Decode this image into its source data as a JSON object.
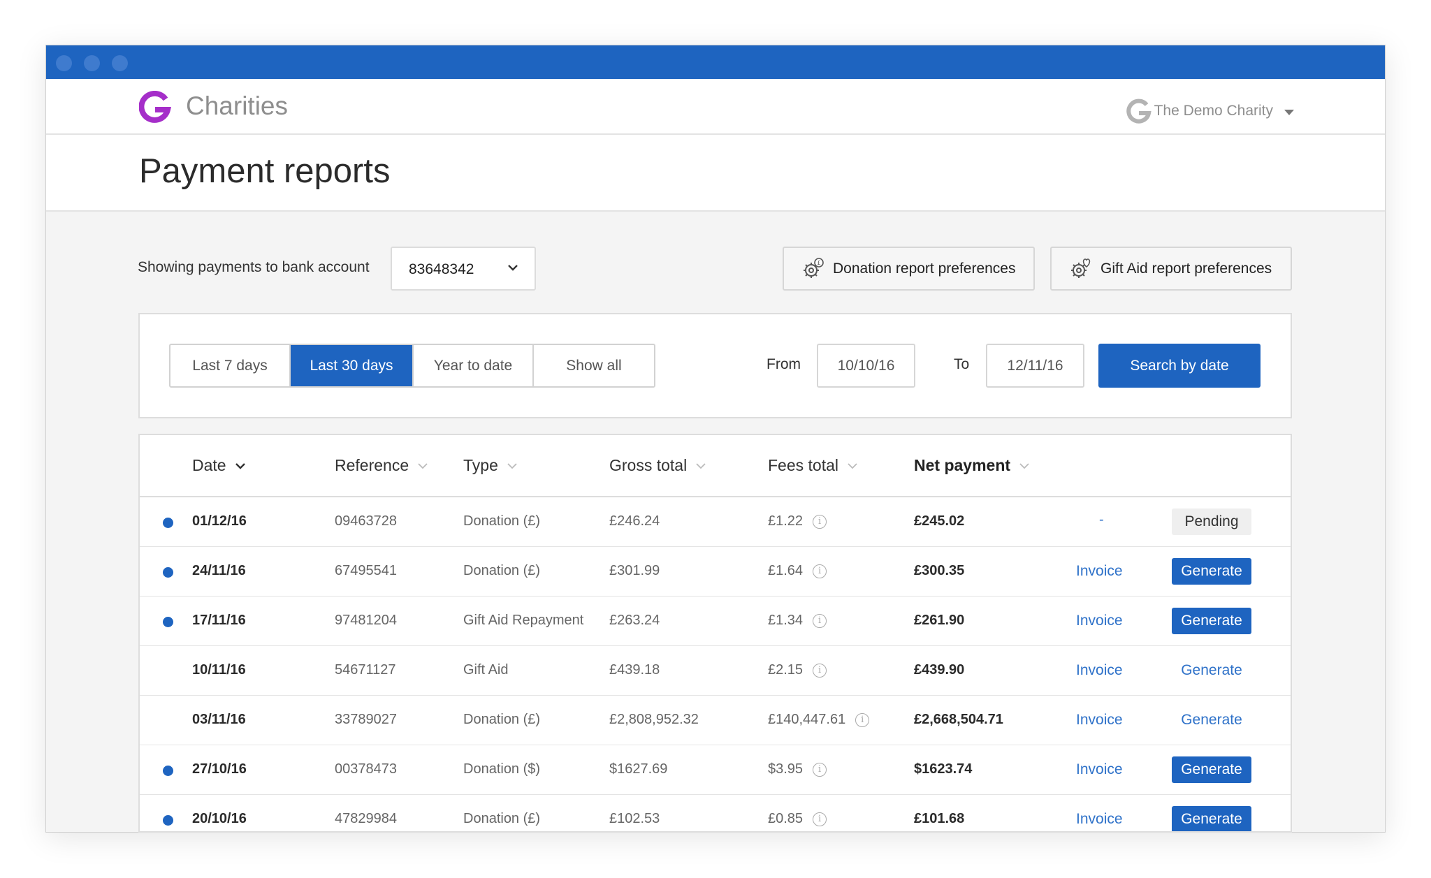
{
  "app": {
    "brand": "Charities",
    "account": "The Demo Charity"
  },
  "page": {
    "title": "Payment reports"
  },
  "controls": {
    "account_label": "Showing payments to bank account",
    "account_value": "83648342",
    "donation_pref": "Donation report preferences",
    "giftaid_pref": "Gift Aid report preferences"
  },
  "filters": {
    "ranges": [
      "Last 7 days",
      "Last 30 days",
      "Year to date",
      "Show all"
    ],
    "active_range": "Last 30 days",
    "from_label": "From",
    "from_value": "10/10/16",
    "to_label": "To",
    "to_value": "12/11/16",
    "search_label": "Search by date"
  },
  "table": {
    "headers": {
      "date": "Date",
      "reference": "Reference",
      "type": "Type",
      "gross": "Gross total",
      "fees": "Fees total",
      "net": "Net payment"
    },
    "rows": [
      {
        "new": true,
        "date": "01/12/16",
        "reference": "09463728",
        "type": "Donation (£)",
        "gross": "£246.24",
        "fees": "£1.22",
        "net": "£245.02",
        "invoice": "-",
        "action": "Pending",
        "action_style": "pending"
      },
      {
        "new": true,
        "date": "24/11/16",
        "reference": "67495541",
        "type": "Donation (£)",
        "gross": "£301.99",
        "fees": "£1.64",
        "net": "£300.35",
        "invoice": "Invoice",
        "action": "Generate",
        "action_style": "button"
      },
      {
        "new": true,
        "date": "17/11/16",
        "reference": "97481204",
        "type": "Gift Aid Repayment",
        "gross": "£263.24",
        "fees": "£1.34",
        "net": "£261.90",
        "invoice": "Invoice",
        "action": "Generate",
        "action_style": "button"
      },
      {
        "new": false,
        "date": "10/11/16",
        "reference": "54671127",
        "type": "Gift Aid",
        "gross": "£439.18",
        "fees": "£2.15",
        "net": "£439.90",
        "invoice": "Invoice",
        "action": "Generate",
        "action_style": "link"
      },
      {
        "new": false,
        "date": "03/11/16",
        "reference": "33789027",
        "type": "Donation (£)",
        "gross": "£2,808,952.32",
        "fees": "£140,447.61",
        "net": "£2,668,504.71",
        "invoice": "Invoice",
        "action": "Generate",
        "action_style": "link"
      },
      {
        "new": true,
        "date": "27/10/16",
        "reference": "00378473",
        "type": "Donation ($)",
        "gross": "$1627.69",
        "fees": "$3.95",
        "net": "$1623.74",
        "invoice": "Invoice",
        "action": "Generate",
        "action_style": "button"
      },
      {
        "new": true,
        "date": "20/10/16",
        "reference": "47829984",
        "type": "Donation (£)",
        "gross": "£102.53",
        "fees": "£0.85",
        "net": "£101.68",
        "invoice": "Invoice",
        "action": "Generate",
        "action_style": "button"
      }
    ]
  },
  "colors": {
    "primary": "#1e64c0",
    "link": "#2f72c9",
    "logo": "#a52ec9"
  }
}
